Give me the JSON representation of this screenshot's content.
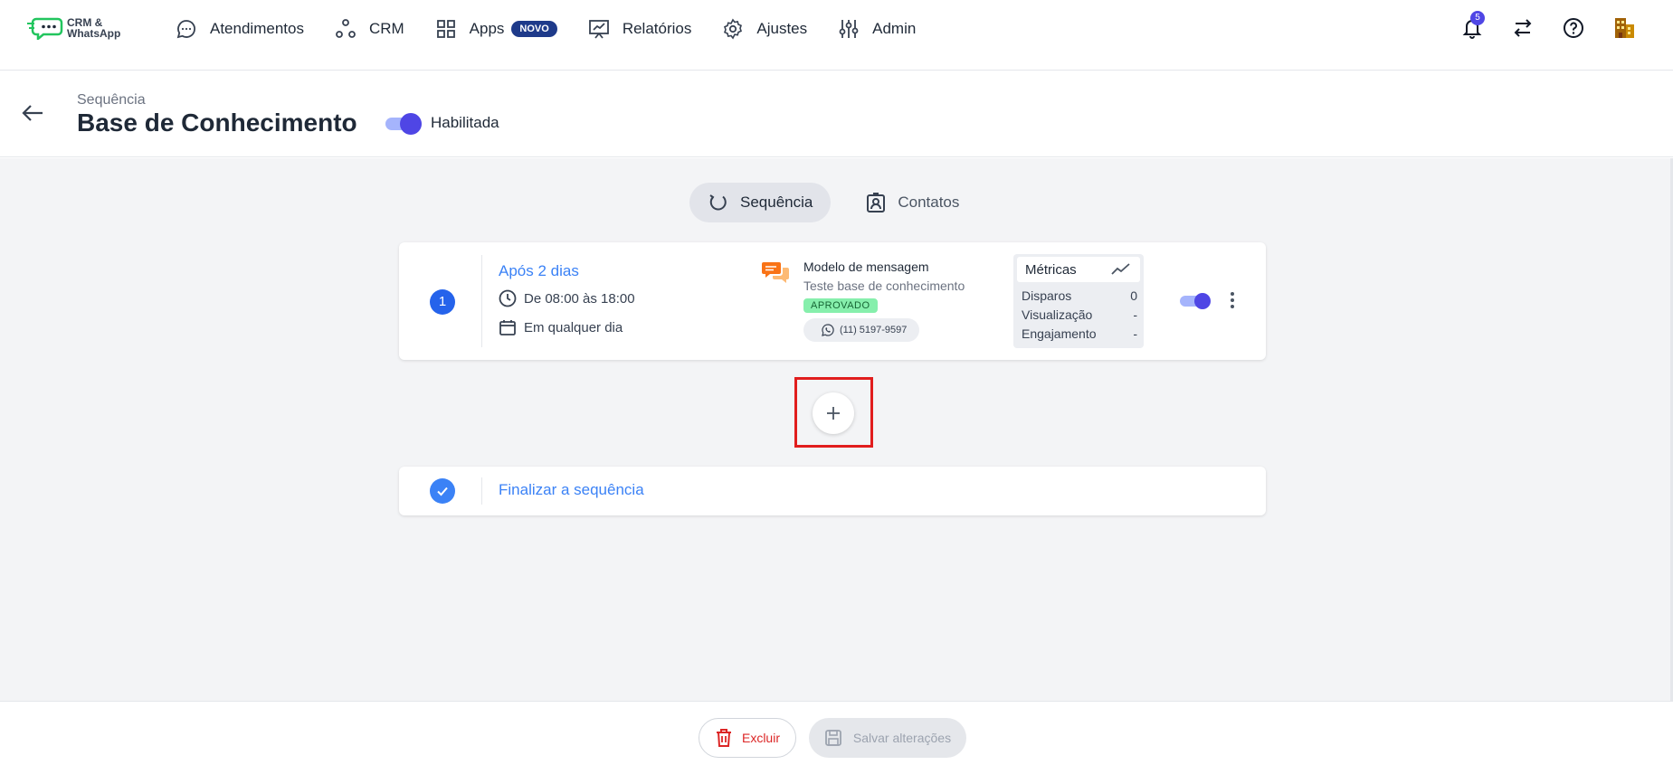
{
  "logo": {
    "line1": "CRM &",
    "line2": "WhatsApp"
  },
  "nav": {
    "items": [
      {
        "label": "Atendimentos",
        "icon": "chat-bubble-icon"
      },
      {
        "label": "CRM",
        "icon": "network-icon"
      },
      {
        "label": "Apps",
        "icon": "grid-icon",
        "badge": "NOVO"
      },
      {
        "label": "Relatórios",
        "icon": "presentation-chart-icon"
      },
      {
        "label": "Ajustes",
        "icon": "gear-icon"
      },
      {
        "label": "Admin",
        "icon": "sliders-icon"
      }
    ],
    "notifications_count": "5"
  },
  "header": {
    "breadcrumb": "Sequência",
    "title": "Base de Conhecimento",
    "toggle_label": "Habilitada",
    "enabled": true
  },
  "tabs": [
    {
      "label": "Sequência",
      "active": true
    },
    {
      "label": "Contatos",
      "active": false
    }
  ],
  "step": {
    "number": "1",
    "title": "Após 2 dias",
    "time": "De 08:00 às 18:00",
    "days": "Em qualquer dia",
    "message": {
      "title": "Modelo de mensagem",
      "subtitle": "Teste base de conhecimento",
      "status": "APROVADO",
      "phone": "(11) 5197-9597"
    },
    "metrics": {
      "title": "Métricas",
      "rows": [
        {
          "label": "Disparos",
          "value": "0"
        },
        {
          "label": "Visualização",
          "value": "-"
        },
        {
          "label": "Engajamento",
          "value": "-"
        }
      ]
    },
    "enabled": true
  },
  "end_step": {
    "label": "Finalizar a sequência"
  },
  "footer": {
    "delete_label": "Excluir",
    "save_label": "Salvar alterações"
  },
  "colors": {
    "accent": "#4f46e5",
    "link": "#3b82f6",
    "danger": "#dc2626",
    "approved": "#86efac",
    "highlight": "#e11d1d"
  }
}
